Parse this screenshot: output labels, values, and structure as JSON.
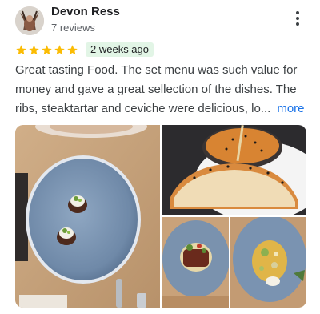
{
  "reviewer": {
    "name": "Devon Ress",
    "review_count": "7 reviews"
  },
  "review": {
    "rating": 5,
    "max_rating": 5,
    "date": "2 weeks ago",
    "lines": [
      "Great tasting Food. The set menu was such value for",
      "money and gave a great sellection of the dishes. The",
      "ribs, steaktartar and ceviche were delicious, lo..."
    ],
    "more_label": "more"
  },
  "colors": {
    "star": "#fbbc04",
    "date_chip_bg": "#e2f5e6",
    "link": "#1a73e8"
  },
  "icons": {
    "menu": "more-vert-icon",
    "star": "star-icon"
  }
}
